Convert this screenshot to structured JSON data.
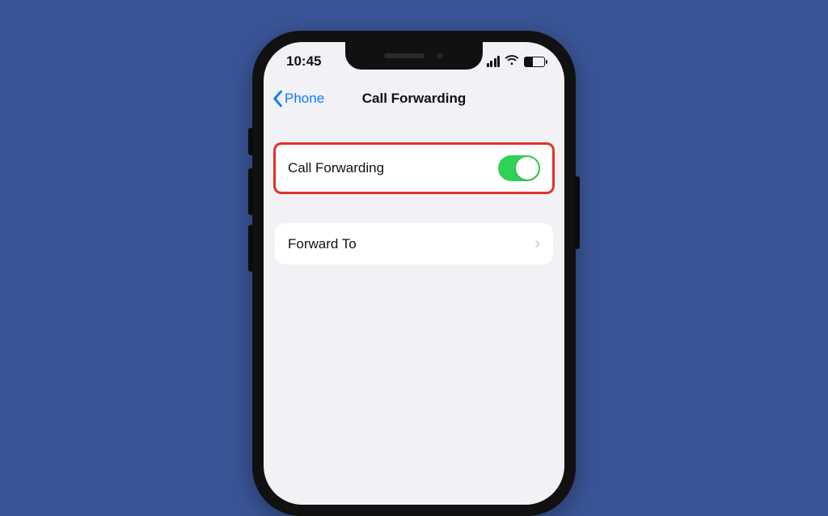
{
  "status": {
    "time": "10:45"
  },
  "nav": {
    "back_label": "Phone",
    "title": "Call Forwarding"
  },
  "rows": {
    "forwarding": {
      "label": "Call Forwarding",
      "enabled": true
    },
    "forward_to": {
      "label": "Forward To"
    }
  },
  "colors": {
    "background": "#3a5597",
    "accent": "#0a7aff",
    "toggle_on": "#30d158",
    "highlight": "#e33127"
  }
}
